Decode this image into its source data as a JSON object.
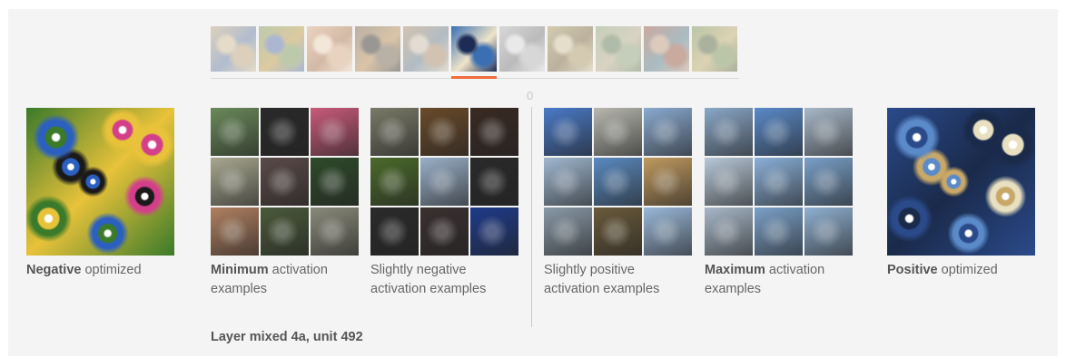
{
  "thumbnails": [
    {
      "name": "unit-thumb-1",
      "colors": [
        "#c9b38f",
        "#7a8fb0",
        "#d8c6a4"
      ]
    },
    {
      "name": "unit-thumb-2",
      "colors": [
        "#8fa870",
        "#c9a85e",
        "#6f86b4"
      ]
    },
    {
      "name": "unit-thumb-3",
      "colors": [
        "#e0b995",
        "#b88a66",
        "#f2dcc2"
      ]
    },
    {
      "name": "unit-thumb-4",
      "colors": [
        "#8a7a66",
        "#c49d6a",
        "#4f4a44"
      ]
    },
    {
      "name": "unit-thumb-5",
      "colors": [
        "#b69a7a",
        "#7d8f9c",
        "#d6c8b6"
      ]
    },
    {
      "name": "unit-thumb-6",
      "colors": [
        "#3a6fb3",
        "#efe4c8",
        "#1d2c55"
      ]
    },
    {
      "name": "unit-thumb-7",
      "colors": [
        "#c0c0c0",
        "#8c8c8c",
        "#e0e0e0"
      ]
    },
    {
      "name": "unit-thumb-8",
      "colors": [
        "#b8a87a",
        "#8d7a55",
        "#d8cca8"
      ]
    },
    {
      "name": "unit-thumb-9",
      "colors": [
        "#9eb08a",
        "#c2b89a",
        "#7a8d6c"
      ]
    },
    {
      "name": "unit-thumb-10",
      "colors": [
        "#a66e5a",
        "#6d8d9a",
        "#c8a890"
      ]
    },
    {
      "name": "unit-thumb-11",
      "colors": [
        "#8da06a",
        "#c8b880",
        "#6d7a54"
      ]
    }
  ],
  "selected_index": 5,
  "axis_zero_label": "0",
  "columns": {
    "negative_optimized": {
      "caption_bold": "Negative",
      "caption_rest": " optimized",
      "colors": [
        "#3a7a2a",
        "#d43f8a",
        "#2b5fc0",
        "#e8c23a",
        "#1a1a1a"
      ]
    },
    "minimum_examples": {
      "caption_bold": "Minimum",
      "caption_rest": " activation examples",
      "cells": [
        "#6a8a5a",
        "#2a2a2a",
        "#c85a7a",
        "#a8a890",
        "#5a4a48",
        "#2e4a2a",
        "#b08060",
        "#4a5a3a",
        "#8a8a7a"
      ]
    },
    "slightly_negative": {
      "caption_bold": "",
      "caption_rest": "Slightly negative activation examples",
      "cells": [
        "#7a7a68",
        "#6a4a2a",
        "#3a2a22",
        "#4a6a2a",
        "#9ab0c8",
        "#2a2a2a",
        "#2a2a2a",
        "#3a3030",
        "#1e3a8a"
      ]
    },
    "slightly_positive": {
      "caption_bold": "",
      "caption_rest": "Slightly positive activation examples",
      "cells": [
        "#4a7ac8",
        "#b8b8b0",
        "#8aaad0",
        "#a0b8d0",
        "#5a8ac0",
        "#c09a60",
        "#8a9aa8",
        "#6a5a3a",
        "#9ab8d8"
      ]
    },
    "maximum_examples": {
      "caption_bold": "Maximum",
      "caption_rest": " activation examples",
      "cells": [
        "#8aa8c8",
        "#5a8ac8",
        "#a8b8c8",
        "#b8c8d8",
        "#8ab0d8",
        "#7aa0c8",
        "#a8b8c8",
        "#7aa0c8",
        "#90b0d0"
      ]
    },
    "positive_optimized": {
      "caption_bold": "Positive",
      "caption_rest": " optimized",
      "colors": [
        "#2a4a8a",
        "#e8e0c0",
        "#5a8ac8",
        "#1a2a4a",
        "#c8a868"
      ]
    }
  },
  "footer_label": "Layer mixed 4a, unit 492"
}
